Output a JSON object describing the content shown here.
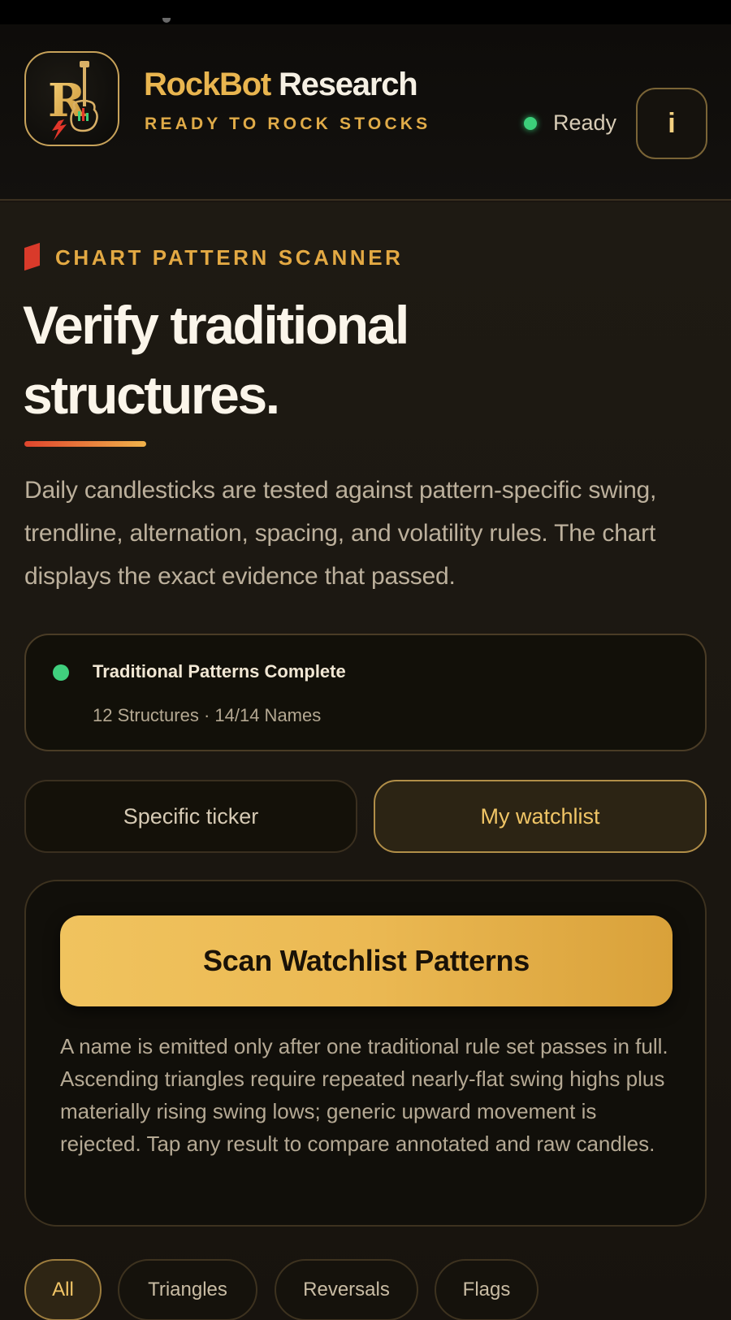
{
  "header": {
    "brand_word_1": "RockBot",
    "brand_word_2": "Research",
    "tagline": "READY TO ROCK STOCKS",
    "status": "Ready",
    "info_label": "i",
    "logo_letter": "R"
  },
  "hero": {
    "eyebrow": "CHART PATTERN SCANNER",
    "headline_line1": "Verify traditional",
    "headline_line2": "structures.",
    "intro": "Daily candlesticks are tested against pattern-specific swing, trendline, alternation, spacing, and volatility rules. The chart displays the exact evidence that passed."
  },
  "status_card": {
    "title": "Traditional Patterns Complete",
    "meta": "12 Structures · 14/14 Names"
  },
  "mode": {
    "ticker_label": "Specific ticker",
    "watchlist_label": "My watchlist",
    "selected": "My watchlist"
  },
  "scan": {
    "button_label": "Scan Watchlist Patterns",
    "description": "A name is emitted only after one traditional rule set passes in full. Ascending triangles require repeated nearly-flat swing highs plus materially rising swing lows; generic upward movement is rejected. Tap any result to compare annotated and raw candles."
  },
  "filters": {
    "chips": [
      "All",
      "Triangles",
      "Reversals",
      "Flags"
    ],
    "selected": "All"
  },
  "colors": {
    "accent_gold": "#e9b54f",
    "status_green": "#3ccf7a",
    "flag_red": "#d93a2a",
    "background": "#1a1510"
  },
  "icons": {
    "logo": "guitar-logo-icon",
    "status": "status-dot-icon",
    "info": "info-icon",
    "eyebrow": "flag-icon"
  }
}
